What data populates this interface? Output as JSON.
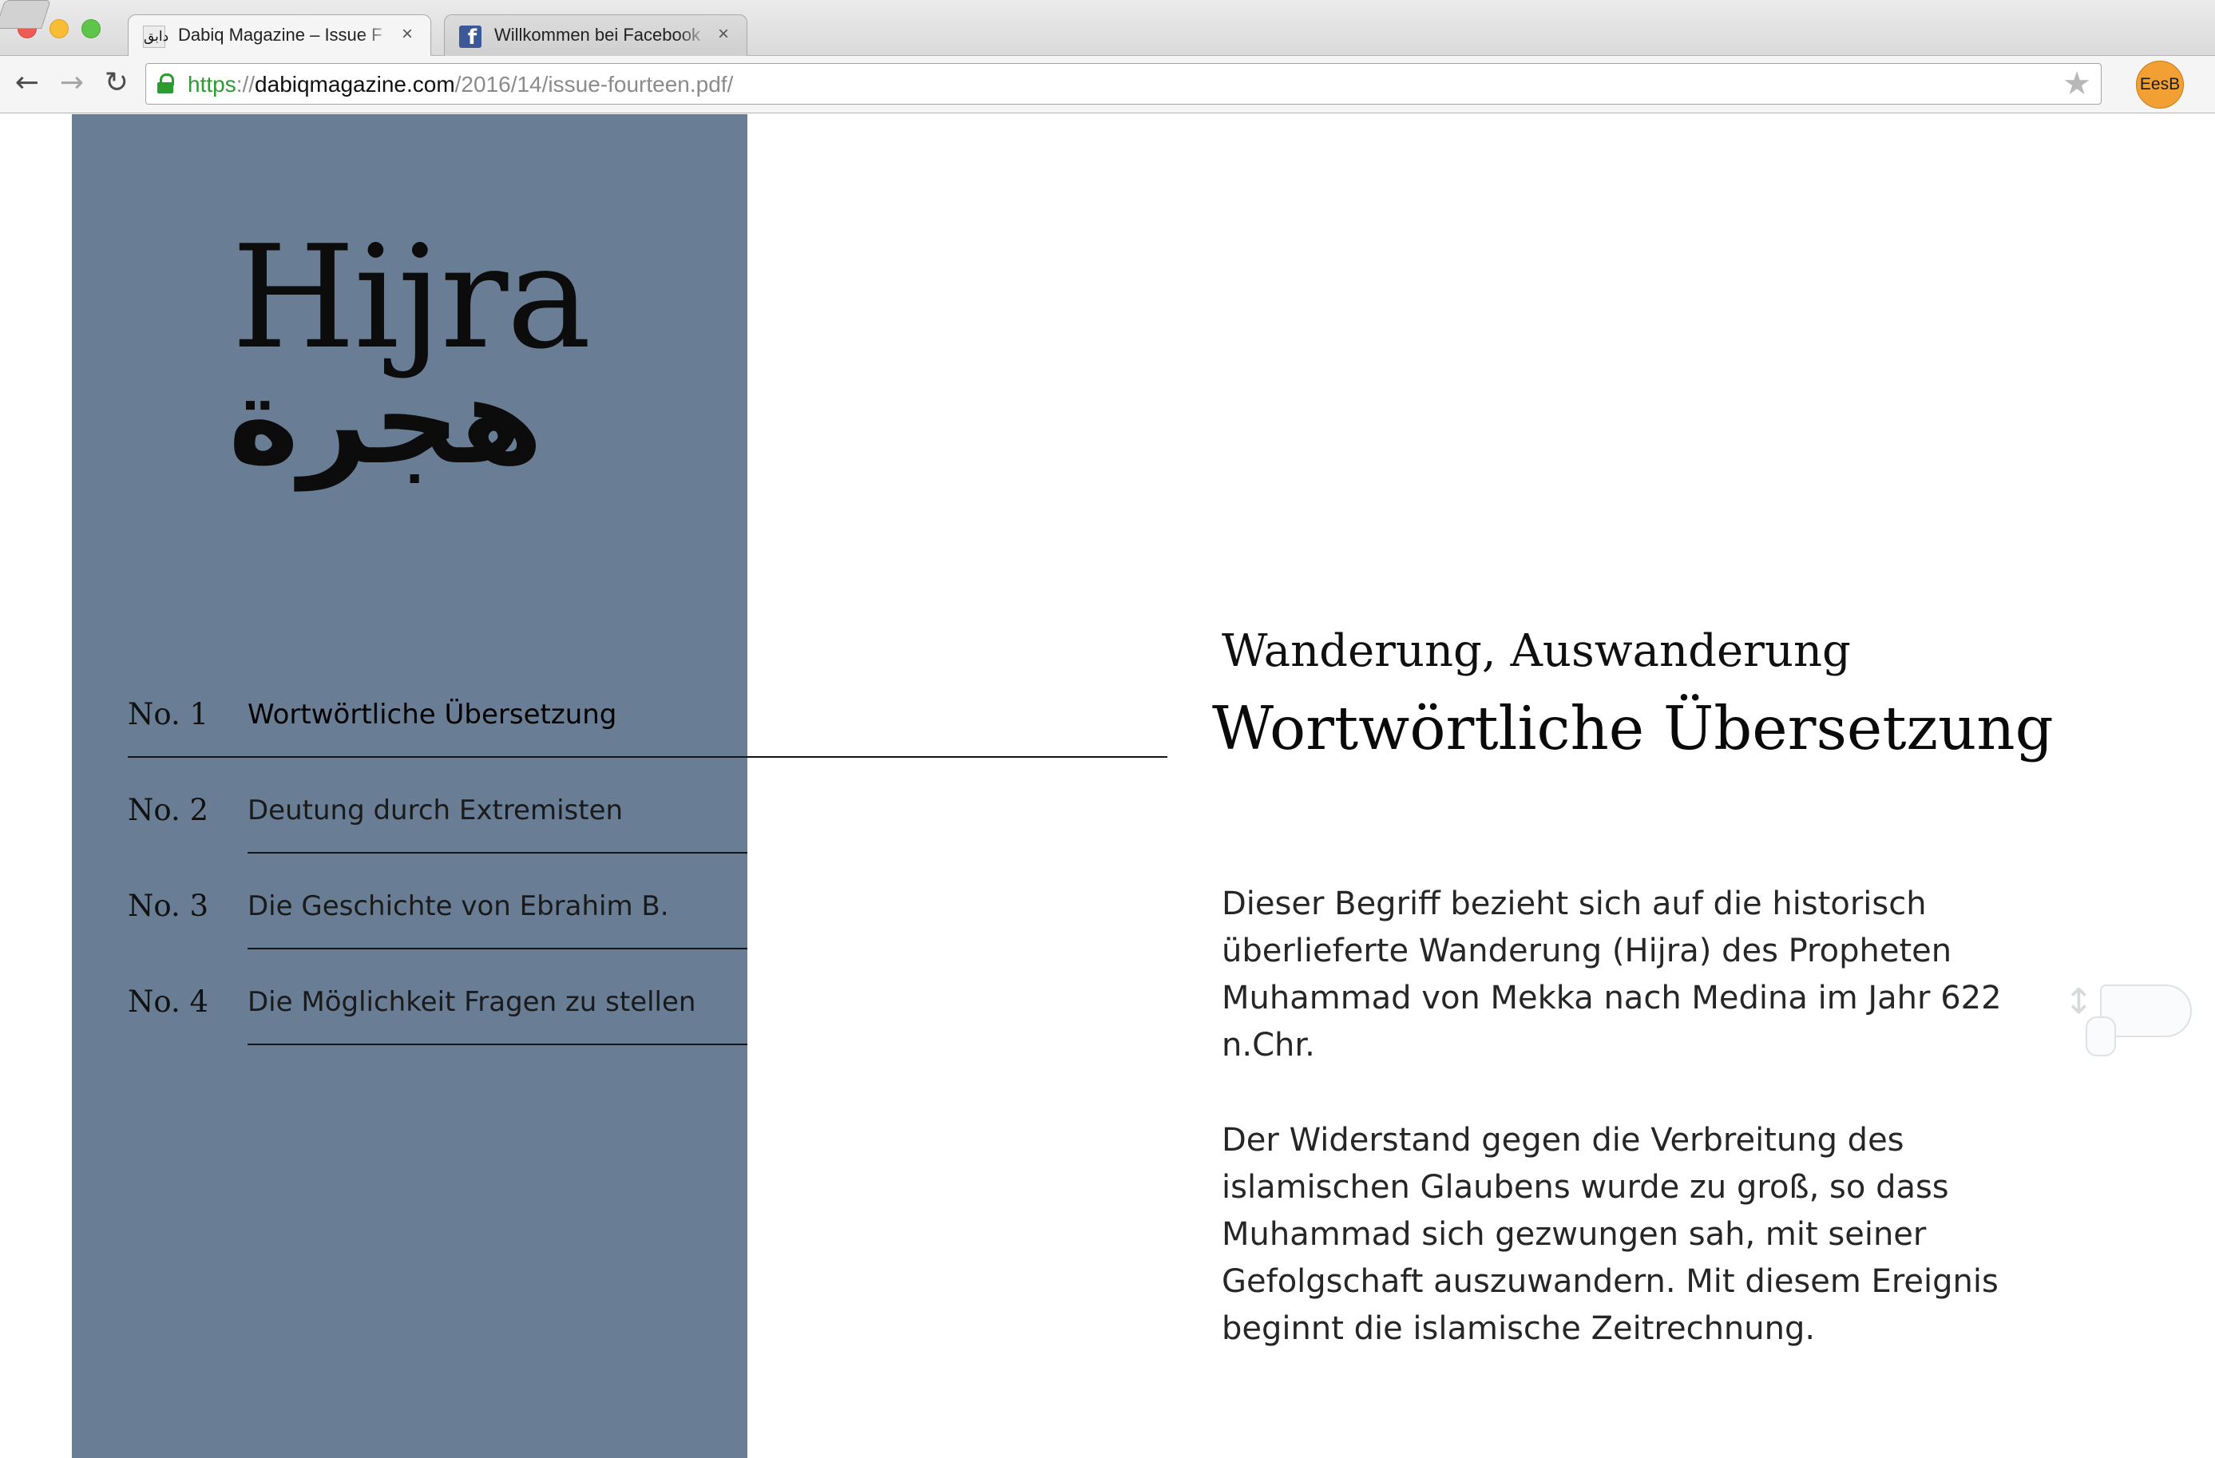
{
  "browser": {
    "tabs": [
      {
        "favicon": "dabiq-favicon",
        "favicon_glyph": "دابق",
        "title": "Dabiq Magazine – Issue F",
        "active": true
      },
      {
        "favicon": "facebook-favicon",
        "favicon_glyph": "f",
        "title": "Willkommen bei Facebook",
        "active": false
      }
    ],
    "close_glyph": "×",
    "url": {
      "scheme": "https",
      "separator": "://",
      "host": "dabiqmagazine.com",
      "path": "/2016/14/issue-fourteen.pdf/"
    },
    "nav_icons": {
      "back": "←",
      "forward": "→",
      "reload": "↻",
      "bookmark": "★"
    },
    "profile": "EesB"
  },
  "page": {
    "brand_latin": "Hijra",
    "brand_arabic": "هجرة",
    "menu": [
      {
        "number": "No. 1",
        "label": "Wortwörtliche Übersetzung",
        "active": true
      },
      {
        "number": "No. 2",
        "label": "Deutung durch Extremisten",
        "active": false
      },
      {
        "number": "No. 3",
        "label": "Die Geschichte von Ebrahim B.",
        "active": false
      },
      {
        "number": "No. 4",
        "label": "Die Möglichkeit Fragen zu stellen",
        "active": false
      }
    ],
    "content": {
      "subtitle": "Wanderung, Auswanderung",
      "headline": "Wortwörtliche Übersetzung",
      "paragraphs": [
        "Dieser Begriff bezieht sich auf die historisch überlieferte Wanderung (Hijra) des Propheten Muhammad von Mekka nach Medina im Jahr 622 n.Chr.",
        "Der Widerstand gegen die Verbreitung des islamischen Glaubens wurde zu groß, so dass Muhammad sich gezwungen sah, mit seiner Gefolgschaft auszuwandern. Mit diesem Ereignis beginnt die islamische Zeitrechnung."
      ]
    },
    "scroll_hint_icon": "scroll-hand-icon"
  },
  "colors": {
    "panel": "#697e94",
    "secure_green": "#2c9b31",
    "profile_orange": "#f2a033"
  }
}
